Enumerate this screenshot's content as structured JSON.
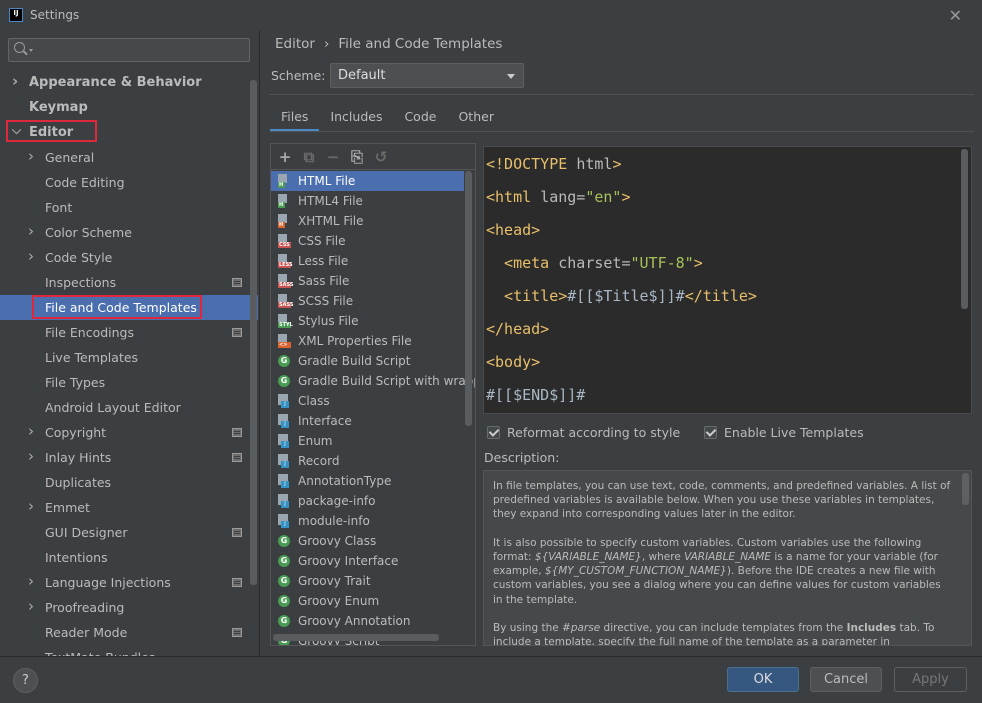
{
  "window": {
    "title": "Settings",
    "app_icon_text": "IJ"
  },
  "search": {
    "placeholder": ""
  },
  "sidebar": {
    "items": [
      {
        "label": "Appearance & Behavior",
        "level": 0,
        "arrow": "right"
      },
      {
        "label": "Keymap",
        "level": 0,
        "arrow": ""
      },
      {
        "label": "Editor",
        "level": 0,
        "arrow": "down"
      },
      {
        "label": "General",
        "level": 1,
        "arrow": "right"
      },
      {
        "label": "Code Editing",
        "level": 1,
        "arrow": ""
      },
      {
        "label": "Font",
        "level": 1,
        "arrow": ""
      },
      {
        "label": "Color Scheme",
        "level": 1,
        "arrow": "right"
      },
      {
        "label": "Code Style",
        "level": 1,
        "arrow": "right"
      },
      {
        "label": "Inspections",
        "level": 1,
        "arrow": "",
        "page_icon": true
      },
      {
        "label": "File and Code Templates",
        "level": 1,
        "arrow": "",
        "selected": true
      },
      {
        "label": "File Encodings",
        "level": 1,
        "arrow": "",
        "page_icon": true
      },
      {
        "label": "Live Templates",
        "level": 1,
        "arrow": ""
      },
      {
        "label": "File Types",
        "level": 1,
        "arrow": ""
      },
      {
        "label": "Android Layout Editor",
        "level": 1,
        "arrow": ""
      },
      {
        "label": "Copyright",
        "level": 1,
        "arrow": "right",
        "page_icon": true
      },
      {
        "label": "Inlay Hints",
        "level": 1,
        "arrow": "right",
        "page_icon": true
      },
      {
        "label": "Duplicates",
        "level": 1,
        "arrow": ""
      },
      {
        "label": "Emmet",
        "level": 1,
        "arrow": "right"
      },
      {
        "label": "GUI Designer",
        "level": 1,
        "arrow": "",
        "page_icon": true
      },
      {
        "label": "Intentions",
        "level": 1,
        "arrow": ""
      },
      {
        "label": "Language Injections",
        "level": 1,
        "arrow": "right",
        "page_icon": true
      },
      {
        "label": "Proofreading",
        "level": 1,
        "arrow": "right"
      },
      {
        "label": "Reader Mode",
        "level": 1,
        "arrow": "",
        "page_icon": true
      },
      {
        "label": "TextMate Bundles",
        "level": 1,
        "arrow": ""
      }
    ]
  },
  "breadcrumb": {
    "parent": "Editor",
    "separator": "›",
    "current": "File and Code Templates"
  },
  "scheme": {
    "label": "Scheme:",
    "value": "Default"
  },
  "tabs": [
    "Files",
    "Includes",
    "Code",
    "Other"
  ],
  "toolbar": {
    "add": "+",
    "add_child": "⧉",
    "remove": "−",
    "copy": "⎘",
    "reset": "↺"
  },
  "templates": [
    {
      "label": "HTML File",
      "icon": "html",
      "selected": true
    },
    {
      "label": "HTML4 File",
      "icon": "html"
    },
    {
      "label": "XHTML File",
      "icon": "xhtml"
    },
    {
      "label": "CSS File",
      "icon": "css"
    },
    {
      "label": "Less File",
      "icon": "less"
    },
    {
      "label": "Sass File",
      "icon": "sass"
    },
    {
      "label": "SCSS File",
      "icon": "scss"
    },
    {
      "label": "Stylus File",
      "icon": "stylus"
    },
    {
      "label": "XML Properties File",
      "icon": "xml"
    },
    {
      "label": "Gradle Build Script",
      "icon": "gradle"
    },
    {
      "label": "Gradle Build Script with wrapper",
      "icon": "gradle"
    },
    {
      "label": "Class",
      "icon": "java"
    },
    {
      "label": "Interface",
      "icon": "java"
    },
    {
      "label": "Enum",
      "icon": "java"
    },
    {
      "label": "Record",
      "icon": "java"
    },
    {
      "label": "AnnotationType",
      "icon": "java"
    },
    {
      "label": "package-info",
      "icon": "java"
    },
    {
      "label": "module-info",
      "icon": "java"
    },
    {
      "label": "Groovy Class",
      "icon": "groovy"
    },
    {
      "label": "Groovy Interface",
      "icon": "groovy"
    },
    {
      "label": "Groovy Trait",
      "icon": "groovy"
    },
    {
      "label": "Groovy Enum",
      "icon": "groovy"
    },
    {
      "label": "Groovy Annotation",
      "icon": "groovy"
    },
    {
      "label": "Groovy Script",
      "icon": "groovy"
    }
  ],
  "editor": {
    "lines": [
      [
        {
          "t": "<!DOCTYPE ",
          "c": "tag"
        },
        {
          "t": "html",
          "c": "attr"
        },
        {
          "t": ">",
          "c": "tag"
        }
      ],
      [
        {
          "t": "<html ",
          "c": "tag"
        },
        {
          "t": "lang=",
          "c": "attr"
        },
        {
          "t": "\"en\"",
          "c": "val"
        },
        {
          "t": ">",
          "c": "tag"
        }
      ],
      [
        {
          "t": "<head>",
          "c": "tag"
        }
      ],
      [
        {
          "t": "  <meta ",
          "c": "tag"
        },
        {
          "t": "charset=",
          "c": "attr"
        },
        {
          "t": "\"UTF-8\"",
          "c": "val"
        },
        {
          "t": ">",
          "c": "tag"
        }
      ],
      [
        {
          "t": "  <title>",
          "c": "tag"
        },
        {
          "t": "#[[$Title$]]#",
          "c": "txt"
        },
        {
          "t": "</title>",
          "c": "tag"
        }
      ],
      [
        {
          "t": "</head>",
          "c": "tag"
        }
      ],
      [
        {
          "t": "<body>",
          "c": "tag"
        }
      ],
      [
        {
          "t": "#[[$END$]]#",
          "c": "txt"
        }
      ]
    ]
  },
  "options": {
    "reformat": "Reformat according to style",
    "live_templates": "Enable Live Templates"
  },
  "description": {
    "label": "Description:",
    "p1": "In file templates, you can use text, code, comments, and predefined variables. A list of predefined variables is available below. When you use these variables in templates, they expand into corresponding values later in the editor.",
    "p2_a": "It is also possible to specify custom variables. Custom variables use the following format: ",
    "p2_var1": "${VARIABLE_NAME}",
    "p2_b": ", where ",
    "p2_var2": "VARIABLE_NAME",
    "p2_c": " is a name for your variable (for example, ",
    "p2_var3": "${MY_CUSTOM_FUNCTION_NAME}",
    "p2_d": "). Before the IDE creates a new file with custom variables, you see a dialog where you can define values for custom variables in the template.",
    "p3_a": "By using the ",
    "p3_parse": "#parse",
    "p3_b": " directive, you can include templates from the ",
    "p3_includes": "Includes",
    "p3_c": " tab. To include a template, specify the full name of the template as a parameter in"
  },
  "buttons": {
    "help": "?",
    "ok": "OK",
    "cancel": "Cancel",
    "apply": "Apply"
  }
}
